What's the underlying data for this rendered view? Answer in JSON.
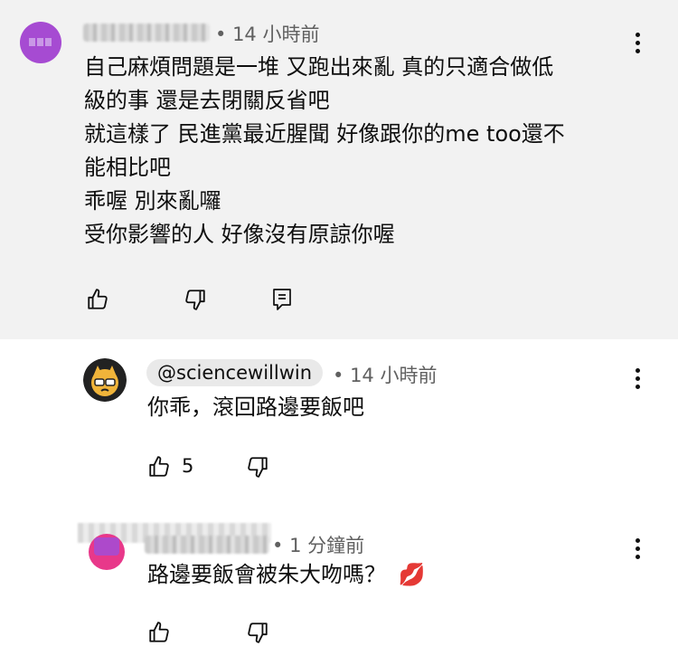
{
  "comment1": {
    "timestamp": "14 小時前",
    "lines": [
      "自己麻煩問題是一堆 又跑出來亂 真的只適合做低",
      "級的事 還是去閉關反省吧",
      "就這樣了 民進黨最近腥聞 好像跟你的me too還不",
      "能相比吧",
      "乖喔 別來亂囉",
      "受你影響的人 好像沒有原諒你喔"
    ]
  },
  "reply1": {
    "handle": "@sciencewillwin",
    "timestamp": "14 小時前",
    "text": "你乖，滾回路邊要飯吧",
    "like_count": "5"
  },
  "reply2": {
    "timestamp": "1 分鐘前",
    "text": "路邊要飯會被朱大吻嗎？",
    "emoji": "💋"
  },
  "colors": {
    "highlight_bg": "#f2f2f2",
    "avatar_purple": "#a64bd2",
    "avatar_pink": "#e8388a",
    "meta_gray": "#606060"
  }
}
